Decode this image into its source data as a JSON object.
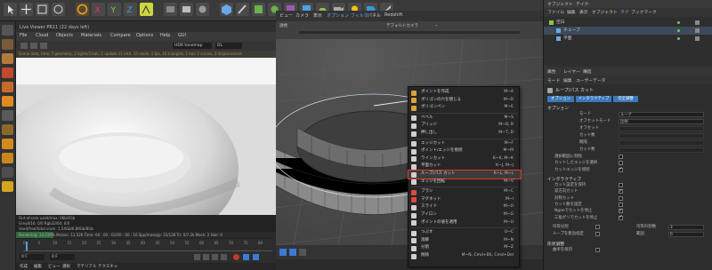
{
  "toolbar": {
    "icons": [
      "cursor-icon",
      "move-icon",
      "scale-icon",
      "rotate-icon",
      "recent-icon",
      "x-axis-icon",
      "y-axis-icon",
      "z-axis-icon",
      "coord-icon",
      "render-region-icon",
      "render-view-icon",
      "render-settings-icon",
      "cube-icon",
      "pen-icon",
      "subdivide-icon",
      "array-icon",
      "field-icon",
      "deformer-icon",
      "floor-icon",
      "camera-icon",
      "light-icon",
      "tag-icon",
      "knife-icon"
    ]
  },
  "live_viewer": {
    "title": "Live Viewer PR11 (22 days left)",
    "menu": [
      "File",
      "Cloud",
      "Objects",
      "Materials",
      "Compare",
      "Options",
      "Help",
      "GUI"
    ],
    "tonemap": "HDR tonemap",
    "display_mode": "DL",
    "preview_bar": "Scene data, time, 7 geometry, 2 lights/2 hair, 1 update 11 mtrl, 15 mesh, 1 fps, 16 triangles, 1 hair 2 curves, 0 displacement",
    "stats": [
      "Out-of-core used/max: 0Kb/4Gb",
      "Grey8/16: 0/0         Rgb32/64: 0/0",
      "Used/free/total vram: 1.54Gb/6.89Gb/8Gb",
      "Rendering: 14.439%   Ms/sec: 11.526   Time: 00 : 00 : 02/00 : 00 : 16   Spp/maxspp: 15/128   Tri: 0/7.2k   Mesh: 2   Hair: 0"
    ],
    "ruler": [
      "0",
      "5",
      "10",
      "15",
      "20",
      "25",
      "30",
      "35",
      "40",
      "45",
      "50",
      "55",
      "60",
      "65",
      "70",
      "75",
      "80"
    ],
    "frame_field": "0 F",
    "start_field": "0 F"
  },
  "bottom_left_tabs": [
    "作成",
    "編集",
    "ビュー",
    "選択",
    "マテリアル",
    "テクスチャ"
  ],
  "viewport": {
    "menu": [
      "ビュー",
      "カメラ",
      "表示",
      "オプション",
      "フィルタ",
      "パネル",
      "Redshift"
    ],
    "perspective_label": "透視",
    "camera_label": "デフォルトカメラ",
    "camera_badge": "・"
  },
  "context_menu": {
    "items": [
      {
        "label": "ポイントを作成",
        "shortcut": "M~A",
        "icon": "point-create-icon",
        "color": "#d9a23a"
      },
      {
        "label": "ポリゴンの穴を閉じる",
        "shortcut": "M~D",
        "icon": "close-hole-icon",
        "color": "#d9a23a"
      },
      {
        "label": "ポリゴンペン",
        "shortcut": "M~E",
        "icon": "polygon-pen-icon",
        "color": "#d9a23a"
      },
      {
        "sep": true
      },
      {
        "label": "ベベル",
        "shortcut": "M~S",
        "icon": "bevel-icon",
        "color": "#cfcfcf"
      },
      {
        "label": "ブリッジ",
        "shortcut": "M~B, B",
        "icon": "bridge-icon",
        "color": "#cfcfcf"
      },
      {
        "label": "押し出し",
        "shortcut": "M~T, D",
        "icon": "extrude-icon",
        "color": "#cfcfcf"
      },
      {
        "sep": true
      },
      {
        "label": "エッジカット",
        "shortcut": "M~F",
        "icon": "edge-cut-icon",
        "color": "#cfcfcf"
      },
      {
        "label": "ポイント/エッジを接続",
        "shortcut": "M~M",
        "icon": "connect-icon",
        "color": "#cfcfcf"
      },
      {
        "label": "ラインカット",
        "shortcut": "K~K, M~K",
        "icon": "line-cut-icon",
        "color": "#cfcfcf"
      },
      {
        "label": "平面カット",
        "shortcut": "K~J, M~J",
        "icon": "plane-cut-icon",
        "color": "#cfcfcf"
      },
      {
        "label": "ループ/パス カット",
        "shortcut": "K~L, M~L",
        "icon": "loop-cut-icon",
        "color": "#cfcfcf",
        "highlight": true
      },
      {
        "label": "エッジを回転",
        "shortcut": "M~V",
        "icon": "spin-edge-icon",
        "color": "#cfcfcf"
      },
      {
        "sep": true
      },
      {
        "label": "ブラシ",
        "shortcut": "M~C",
        "icon": "brush-icon",
        "color": "#d94c3b"
      },
      {
        "label": "マグネット",
        "shortcut": "M~I",
        "icon": "magnet-icon",
        "color": "#d94c3b"
      },
      {
        "label": "スライド",
        "shortcut": "M~O",
        "icon": "slide-icon",
        "color": "#cfcfcf"
      },
      {
        "label": "アイロン",
        "shortcut": "M~G",
        "icon": "iron-icon",
        "color": "#cfcfcf"
      },
      {
        "label": "ポイントの値を適用",
        "shortcut": "M~U",
        "icon": "apply-value-icon",
        "color": "#cfcfcf"
      },
      {
        "sep": true
      },
      {
        "label": "つぶす",
        "shortcut": "U~C",
        "icon": "collapse-icon",
        "color": "#cfcfcf"
      },
      {
        "label": "溶解",
        "shortcut": "M~N",
        "icon": "dissolve-icon",
        "color": "#cfcfcf"
      },
      {
        "label": "分割",
        "shortcut": "M~Z",
        "icon": "split-icon",
        "color": "#cfcfcf"
      },
      {
        "label": "削除",
        "shortcut": "M~N, Cmd+BS, Cmd+Del",
        "icon": "delete-icon",
        "color": "#cfcfcf"
      }
    ]
  },
  "right_panel": {
    "top_tabs": [
      "オブジェクト",
      "テイク"
    ],
    "object_menu": [
      "ファイル",
      "編集",
      "表示",
      "オブジェクト",
      "タグ",
      "ブックマーク"
    ],
    "objects": [
      {
        "name": "空白",
        "indent": 0
      },
      {
        "name": "チューブ",
        "indent": 1,
        "selected": true
      },
      {
        "name": "平面",
        "indent": 1
      }
    ],
    "attr_tabs": [
      "属性",
      "レイヤー",
      "構造"
    ],
    "attr_menu": [
      "モード",
      "編集",
      "ユーザーデータ"
    ],
    "tool_title": "ループ/パス カット",
    "subtabs": [
      "オプション",
      "インタラクティブ",
      "完全調整"
    ],
    "section_options": "オプション",
    "options": [
      {
        "label": "モード",
        "value": "ループ"
      },
      {
        "label": "オフセットモード",
        "value": "比例"
      },
      {
        "label": "オフセット",
        "value": ""
      },
      {
        "label": "カット数",
        "value": ""
      },
      {
        "label": "間隔",
        "value": ""
      },
      {
        "label": "カット数",
        "value": ""
      }
    ],
    "checks1": [
      {
        "label": "選択範囲に制限",
        "on": false
      },
      {
        "label": "カットしたエッジを選択",
        "on": false
      },
      {
        "label": "カットエッジを接続",
        "on": true
      }
    ],
    "section_interactive": "インタラクティブ",
    "checks2": [
      {
        "label": "カット設定を保持",
        "on": false
      },
      {
        "label": "双方向カット",
        "on": true
      },
      {
        "label": "対称カット",
        "on": false
      },
      {
        "label": "カット数を固定",
        "on": false
      },
      {
        "label": "Ngonでカットを停止",
        "on": true
      },
      {
        "label": "三角ポリでカットを停止",
        "on": true
      }
    ],
    "polish_left": {
      "label": "均等分割",
      "on": false
    },
    "polish_right_label": "均等の割数",
    "polish_right_value": "3",
    "loop_left": {
      "label": "ループを無効指定",
      "on": false
    },
    "loop_right_label": "範囲",
    "loop_right_value": "0",
    "section_shape": "形状調整",
    "shape_row": {
      "label": "曲率を保持",
      "on": false
    }
  }
}
